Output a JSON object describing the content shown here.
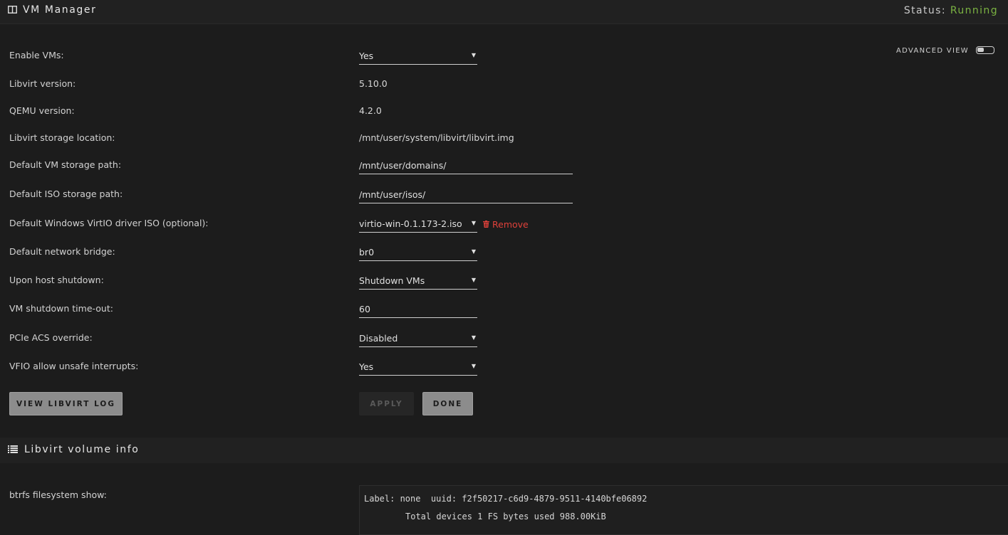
{
  "header": {
    "title": "VM Manager",
    "status_label": "Status:",
    "status_value": "Running",
    "status_color": "#7bb342"
  },
  "advanced_view": {
    "label": "ADVANCED VIEW",
    "enabled": false
  },
  "settings": {
    "enable_vms": {
      "label": "Enable VMs:",
      "value": "Yes"
    },
    "libvirt_version": {
      "label": "Libvirt version:",
      "value": "5.10.0"
    },
    "qemu_version": {
      "label": "QEMU version:",
      "value": "4.2.0"
    },
    "libvirt_storage": {
      "label": "Libvirt storage location:",
      "value": "/mnt/user/system/libvirt/libvirt.img"
    },
    "vm_storage_path": {
      "label": "Default VM storage path:",
      "value": "/mnt/user/domains/"
    },
    "iso_storage_path": {
      "label": "Default ISO storage path:",
      "value": "/mnt/user/isos/"
    },
    "virtio_iso": {
      "label": "Default Windows VirtIO driver ISO (optional):",
      "value": "virtio-win-0.1.173-2.iso",
      "remove_label": "Remove"
    },
    "network_bridge": {
      "label": "Default network bridge:",
      "value": "br0"
    },
    "host_shutdown": {
      "label": "Upon host shutdown:",
      "value": "Shutdown VMs"
    },
    "shutdown_timeout": {
      "label": "VM shutdown time-out:",
      "value": "60"
    },
    "pcie_acs": {
      "label": "PCIe ACS override:",
      "value": "Disabled"
    },
    "vfio_unsafe": {
      "label": "VFIO allow unsafe interrupts:",
      "value": "Yes"
    }
  },
  "buttons": {
    "view_log": "VIEW LIBVIRT LOG",
    "apply": "APPLY",
    "done": "DONE"
  },
  "volume_info": {
    "title": "Libvirt volume info",
    "btrfs_label": "btrfs filesystem show:",
    "btrfs_lines": [
      "Label: none  uuid: f2f50217-c6d9-4879-9511-4140bfe06892",
      "\tTotal devices 1 FS bytes used 988.00KiB"
    ]
  },
  "colors": {
    "background": "#1c1c1c",
    "header_bg": "#212121",
    "remove_red": "#e0413a",
    "button_gray": "#8c8c8c"
  }
}
